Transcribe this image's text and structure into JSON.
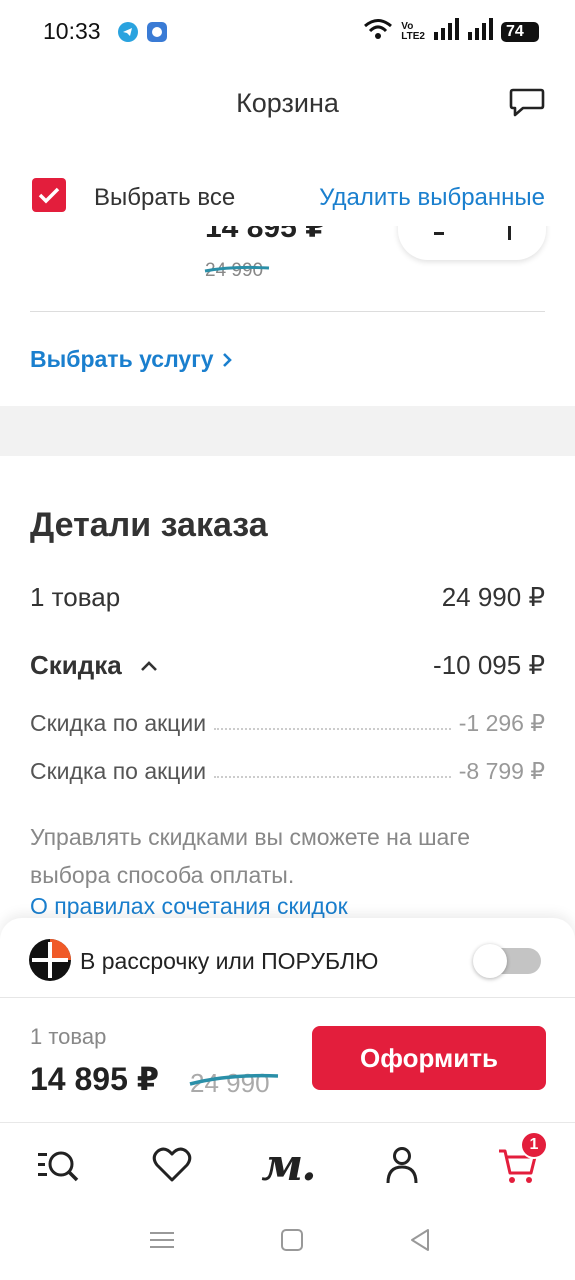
{
  "status_bar": {
    "time": "10:33",
    "battery": "74",
    "network_label_top": "Vo",
    "network_label_bottom": "LTE2"
  },
  "header": {
    "title": "Корзина",
    "chat_icon": "chat-bubble-icon"
  },
  "select_bar": {
    "select_all_label": "Выбрать все",
    "select_all_checked": true,
    "delete_selected_label": "Удалить выбранные"
  },
  "product": {
    "price": "14 895 ₽",
    "old_price": "24 990"
  },
  "service": {
    "choose_label": "Выбрать услугу"
  },
  "order_details": {
    "title": "Детали заказа",
    "items_label": "1 товар",
    "items_value": "24 990 ₽",
    "discount_label": "Скидка",
    "discount_value": "-10 095 ₽",
    "discount_breakdown": [
      {
        "label": "Скидка по акции",
        "value": "-1 296 ₽"
      },
      {
        "label": "Скидка по акции",
        "value": "-8 799 ₽"
      }
    ],
    "note": "Управлять скидками вы сможете на шаге выбора способа оплаты.",
    "rules_link": "О правилах сочетания скидок"
  },
  "installment": {
    "label": "В рассрочку или ПОРУБЛЮ",
    "enabled": false
  },
  "checkout": {
    "count": "1 товар",
    "total": "14 895 ₽",
    "old_total": "24 990",
    "button_label": "Оформить"
  },
  "bottom_nav": {
    "items": [
      {
        "name": "catalog-search",
        "icon": "catalog-search-icon"
      },
      {
        "name": "favorites",
        "icon": "heart-icon"
      },
      {
        "name": "home",
        "logo_text": "м."
      },
      {
        "name": "profile",
        "icon": "user-icon"
      },
      {
        "name": "cart",
        "icon": "cart-icon",
        "badge": "1"
      }
    ]
  },
  "colors": {
    "accent_red": "#e31e3c",
    "link_blue": "#1a7fce"
  }
}
